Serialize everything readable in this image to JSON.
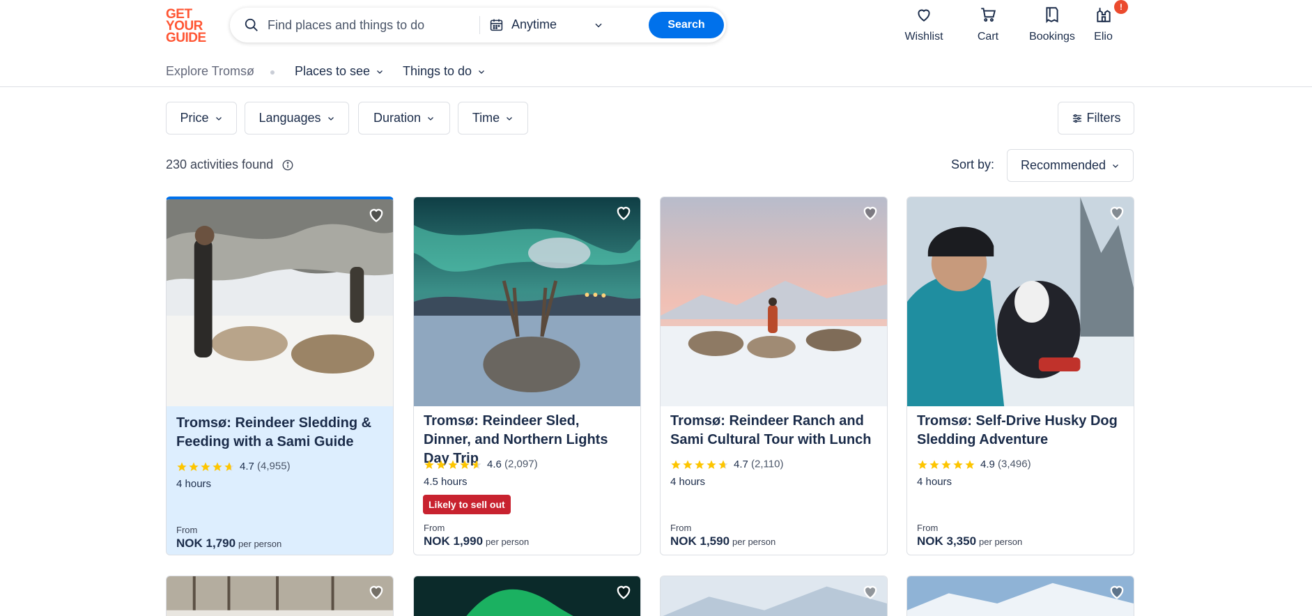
{
  "brand": {
    "logo_lines": [
      "GET",
      "YOUR",
      "GUIDE"
    ],
    "accent": "#ff5533",
    "primary": "#0071eb"
  },
  "search": {
    "placeholder": "Find places and things to do",
    "date_label": "Anytime",
    "button_label": "Search"
  },
  "nav": {
    "wishlist": "Wishlist",
    "cart": "Cart",
    "bookings": "Bookings",
    "profile": "Elio",
    "profile_badge": "!"
  },
  "subnav": {
    "explore": "Explore Tromsø",
    "places": "Places to see",
    "things": "Things to do"
  },
  "filters": {
    "price": "Price",
    "languages": "Languages",
    "duration": "Duration",
    "time": "Time",
    "all": "Filters"
  },
  "results": {
    "count_text": "230 activities found",
    "sort_label": "Sort by:",
    "sort_value": "Recommended"
  },
  "activities": [
    {
      "title": "Tromsø: Reindeer Sledding & Feeding with a Sami Guide",
      "rating": "4.7",
      "reviews": "(4,955)",
      "duration": "4 hours",
      "badge": "",
      "from": "From",
      "price": "NOK 1,790",
      "per": "per person",
      "stars": 4.7
    },
    {
      "title": "Tromsø: Reindeer Sled, Dinner, and Northern Lights Day Trip",
      "rating": "4.6",
      "reviews": "(2,097)",
      "duration": "4.5 hours",
      "badge": "Likely to sell out",
      "from": "From",
      "price": "NOK 1,990",
      "per": "per person",
      "stars": 4.6
    },
    {
      "title": "Tromsø: Reindeer Ranch and Sami Cultural Tour with Lunch",
      "rating": "4.7",
      "reviews": "(2,110)",
      "duration": "4 hours",
      "badge": "",
      "from": "From",
      "price": "NOK 1,590",
      "per": "per person",
      "stars": 4.7
    },
    {
      "title": "Tromsø: Self-Drive Husky Dog Sledding Adventure",
      "rating": "4.9",
      "reviews": "(3,496)",
      "duration": "4 hours",
      "badge": "",
      "from": "From",
      "price": "NOK 3,350",
      "per": "per person",
      "stars": 4.9
    }
  ]
}
